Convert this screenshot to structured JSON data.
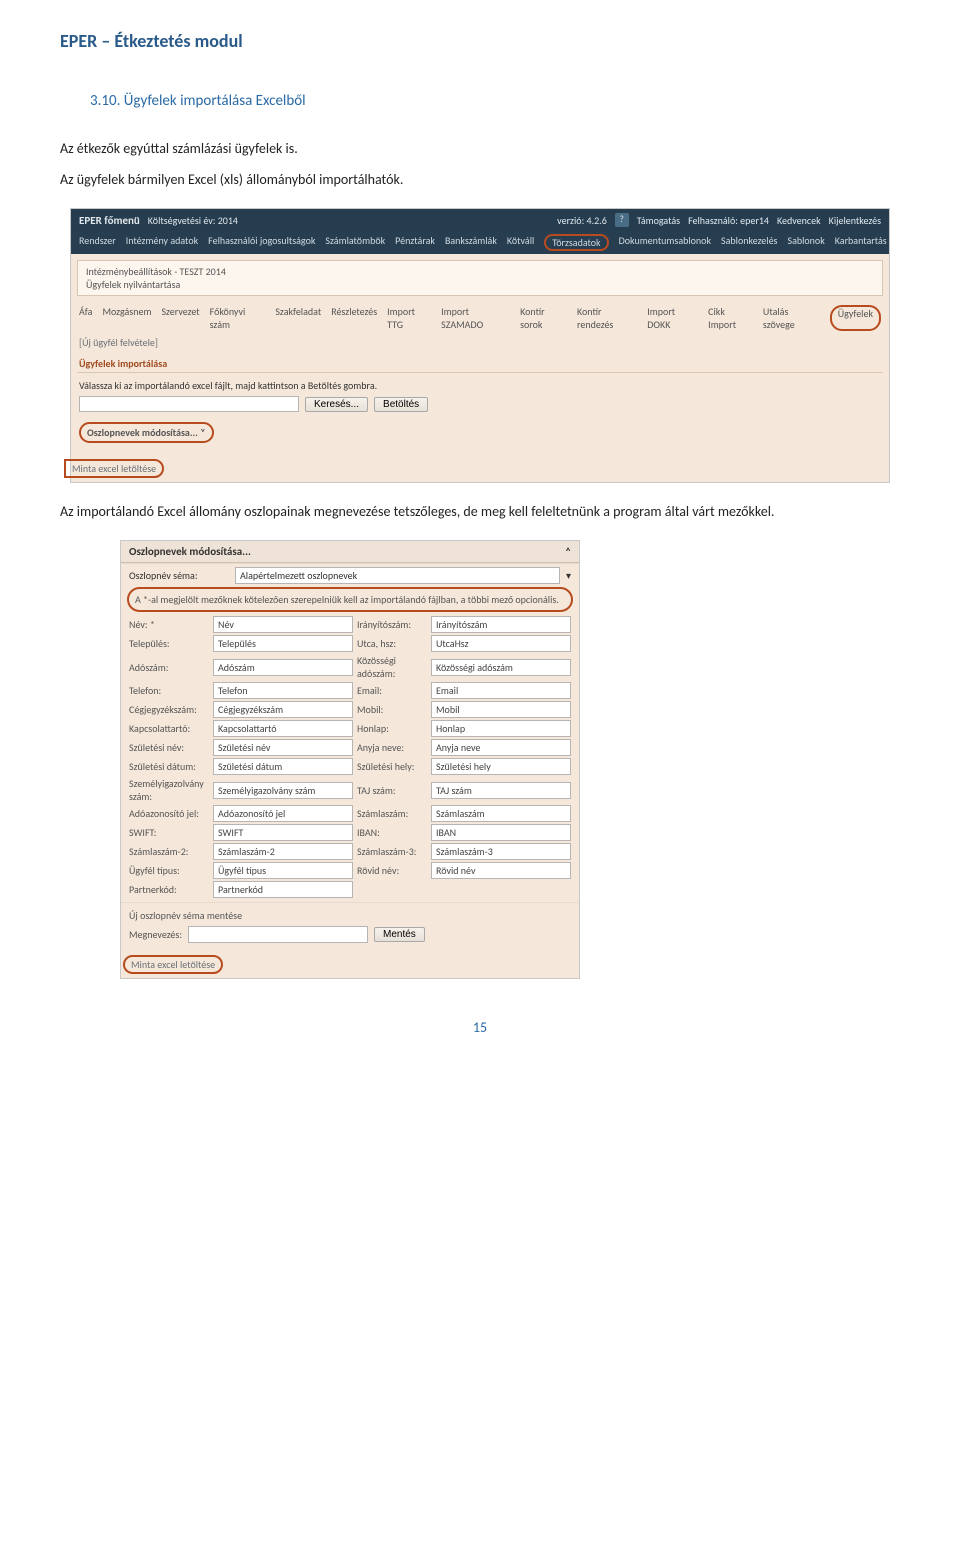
{
  "doc_title": "EPER – Étkeztetés modul",
  "section_heading": "3.10. Ügyfelek importálása Excelből",
  "para1": "Az étkezők egyúttal számlázási ügyfelek is.",
  "para2": "Az ügyfelek bármilyen Excel (xls) állományból importálhatók.",
  "para3": "Az importálandó Excel állomány oszlopainak megnevezése tetszőleges, de meg kell feleltetnünk a program által várt mezőkkel.",
  "page_num": "15",
  "s1": {
    "brand": "EPER főmenü",
    "year_label": "Költségvetési év: 2014",
    "version": "verzió: 4.2.6",
    "help": "?",
    "support": "Támogatás",
    "user_label": "Felhasználó: eper14",
    "fav": "Kedvencek",
    "logout": "Kijelentkezés",
    "menu": [
      "Rendszer",
      "Intézmény adatok",
      "Felhasználói jogosultságok",
      "Számlatömbök",
      "Pénztárak",
      "Bankszámlák",
      "Kötváll",
      "Törzsadatok",
      "Dokumentumsablonok",
      "Sablonkezelés",
      "Sablonok",
      "Karbantartás"
    ],
    "menu_highlight_index": 7,
    "bread1": "Intézménybeállítások - TESZT 2014",
    "bread2": "Ügyfelek nyilvántartása",
    "tabs": [
      "Áfa",
      "Mozgásnem",
      "Szervezet",
      "Főkönyvi szám",
      "Szakfeladat",
      "Részletezés",
      "Import TTG",
      "Import SZAMADO",
      "Kontír sorok",
      "Kontír rendezés",
      "Import DOKK",
      "Cikk Import",
      "Utalás szövege",
      "Ügyfelek"
    ],
    "tab_highlight_index": 13,
    "new_link": "[Új ügyfél felvétele]",
    "panel_title": "Ügyfelek importálása",
    "instr": "Válassza ki az importálandó excel fájlt, majd kattintson a Betöltés gombra.",
    "browse": "Keresés...",
    "load": "Betöltés",
    "colmod": "Oszlopnevek módosítása...  ˅",
    "sample": "Minta excel letöltése"
  },
  "s2": {
    "panel_title": "Oszlopnevek módosítása...",
    "chev": "˄",
    "scheme_label": "Oszlopnév séma:",
    "scheme_value": "Alapértelmezett oszlopnevek",
    "note": "A *-al megjelölt mezőknek kötelezően szerepelniük kell az importálandó fájlban, a többi mező opcionális.",
    "fields": [
      {
        "l": "Név: *",
        "v": "Név",
        "l2": "Irányítószám:",
        "v2": "Irányítószám"
      },
      {
        "l": "Település:",
        "v": "Település",
        "l2": "Utca, hsz:",
        "v2": "UtcaHsz"
      },
      {
        "l": "Adószám:",
        "v": "Adószám",
        "l2": "Közösségi adószám:",
        "v2": "Közösségi adószám"
      },
      {
        "l": "Telefon:",
        "v": "Telefon",
        "l2": "Email:",
        "v2": "Email"
      },
      {
        "l": "Cégjegyzékszám:",
        "v": "Cégjegyzékszám",
        "l2": "Mobil:",
        "v2": "Mobil"
      },
      {
        "l": "Kapcsolattartó:",
        "v": "Kapcsolattartó",
        "l2": "Honlap:",
        "v2": "Honlap"
      },
      {
        "l": "Születési név:",
        "v": "Születési név",
        "l2": "Anyja neve:",
        "v2": "Anyja neve"
      },
      {
        "l": "Születési dátum:",
        "v": "Születési dátum",
        "l2": "Születési hely:",
        "v2": "Születési hely"
      },
      {
        "l": "Személyigazolvány szám:",
        "v": "Személyigazolvány szám",
        "l2": "TAJ szám:",
        "v2": "TAJ szám"
      },
      {
        "l": "Adóazonosító jel:",
        "v": "Adóazonosító jel",
        "l2": "Számlaszám:",
        "v2": "Számlaszám"
      },
      {
        "l": "SWIFT:",
        "v": "SWIFT",
        "l2": "IBAN:",
        "v2": "IBAN"
      },
      {
        "l": "Számlaszám-2:",
        "v": "Számlaszám-2",
        "l2": "Számlaszám-3:",
        "v2": "Számlaszám-3"
      },
      {
        "l": "Ügyfél típus:",
        "v": "Ügyfél típus",
        "l2": "Rövid név:",
        "v2": "Rövid név"
      },
      {
        "l": "Partnerkód:",
        "v": "Partnerkód",
        "l2": "",
        "v2": ""
      }
    ],
    "save_head": "Új oszlopnév séma mentése",
    "save_label": "Megnevezés:",
    "save_btn": "Mentés",
    "sample": "Minta excel letöltése"
  }
}
